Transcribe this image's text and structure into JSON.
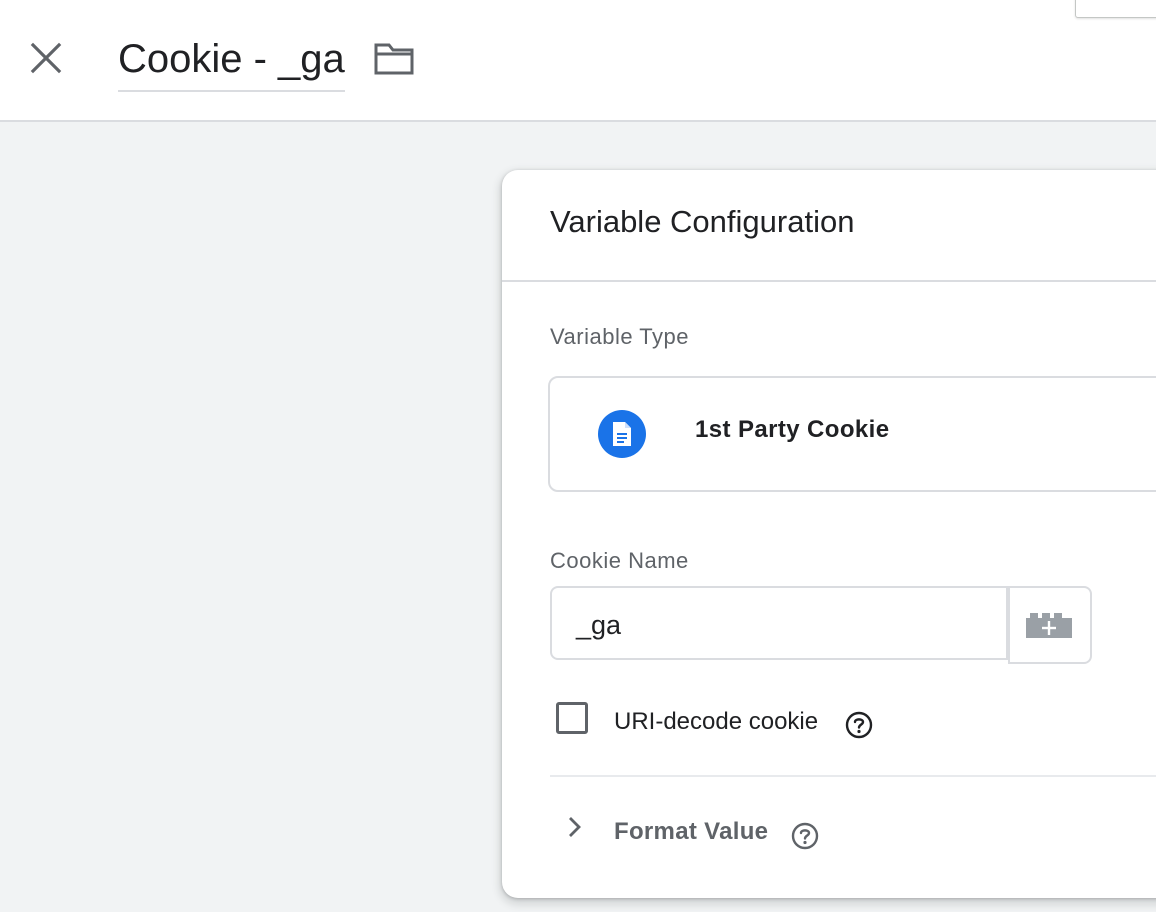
{
  "header": {
    "close_icon": "close-icon",
    "title": "Cookie - _ga",
    "folder_icon": "folder-icon"
  },
  "card": {
    "title": "Variable Configuration",
    "variable_type": {
      "label": "Variable Type",
      "value": "1st Party Cookie",
      "icon": "document-icon",
      "icon_color": "#1a73e8"
    },
    "cookie_name": {
      "label": "Cookie Name",
      "value": "_ga",
      "picker_icon": "variable-brick-plus-icon"
    },
    "uri_decode": {
      "label": "URI-decode cookie",
      "checked": false,
      "help_icon": "help-icon"
    },
    "format_value": {
      "label": "Format Value",
      "expanded": false,
      "chevron_icon": "chevron-right-icon",
      "help_icon": "help-icon"
    }
  },
  "colors": {
    "background": "#f1f3f4",
    "accent": "#1a73e8",
    "border": "#dadce0",
    "secondary_text": "#5f6368"
  }
}
